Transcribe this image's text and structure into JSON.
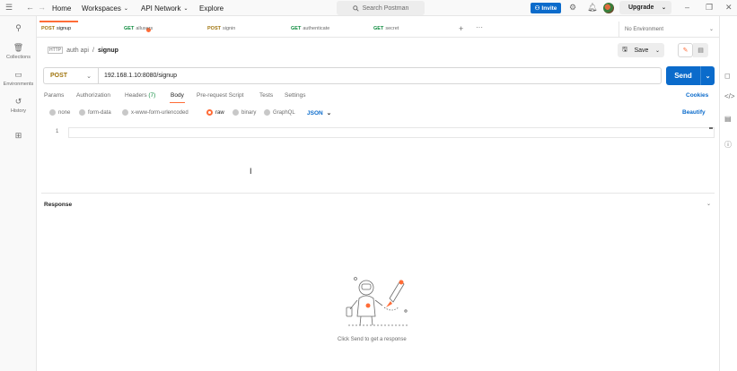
{
  "topbar": {
    "home": "Home",
    "workspaces": "Workspaces",
    "api_network": "API Network",
    "explore": "Explore",
    "search_placeholder": "Search Postman",
    "invite": "Invite",
    "upgrade": "Upgrade"
  },
  "sidebar": {
    "items": [
      {
        "label": ""
      },
      {
        "label": "Collections"
      },
      {
        "label": "Environments"
      },
      {
        "label": "History"
      },
      {
        "label": ""
      }
    ]
  },
  "tabs": [
    {
      "method": "POST",
      "name": "signup"
    },
    {
      "method": "GET",
      "name": "allusers"
    },
    {
      "method": "POST",
      "name": "signin"
    },
    {
      "method": "GET",
      "name": "authenticate"
    },
    {
      "method": "GET",
      "name": "secret"
    }
  ],
  "environment": "No Environment",
  "breadcrumb": {
    "parent": "auth api",
    "current": "signup"
  },
  "save_label": "Save",
  "request": {
    "method": "POST",
    "url": "192.168.1.10:8080/signup",
    "send": "Send"
  },
  "request_tabs": {
    "params": "Params",
    "authorization": "Authorization",
    "headers": "Headers",
    "headers_count": "(7)",
    "body": "Body",
    "prerequest": "Pre-request Script",
    "tests": "Tests",
    "settings": "Settings",
    "cookies": "Cookies"
  },
  "body_types": {
    "none": "none",
    "form_data": "form-data",
    "urlencoded": "x-www-form-urlencoded",
    "raw": "raw",
    "binary": "binary",
    "graphql": "GraphQL",
    "format": "JSON",
    "beautify": "Beautify",
    "selected": "raw"
  },
  "editor": {
    "line_number": "1"
  },
  "response": {
    "title": "Response",
    "hint": "Click Send to get a response"
  },
  "colors": {
    "accent": "#ff6c37",
    "primary": "#0b6bcb",
    "post_method": "#a0750e"
  }
}
